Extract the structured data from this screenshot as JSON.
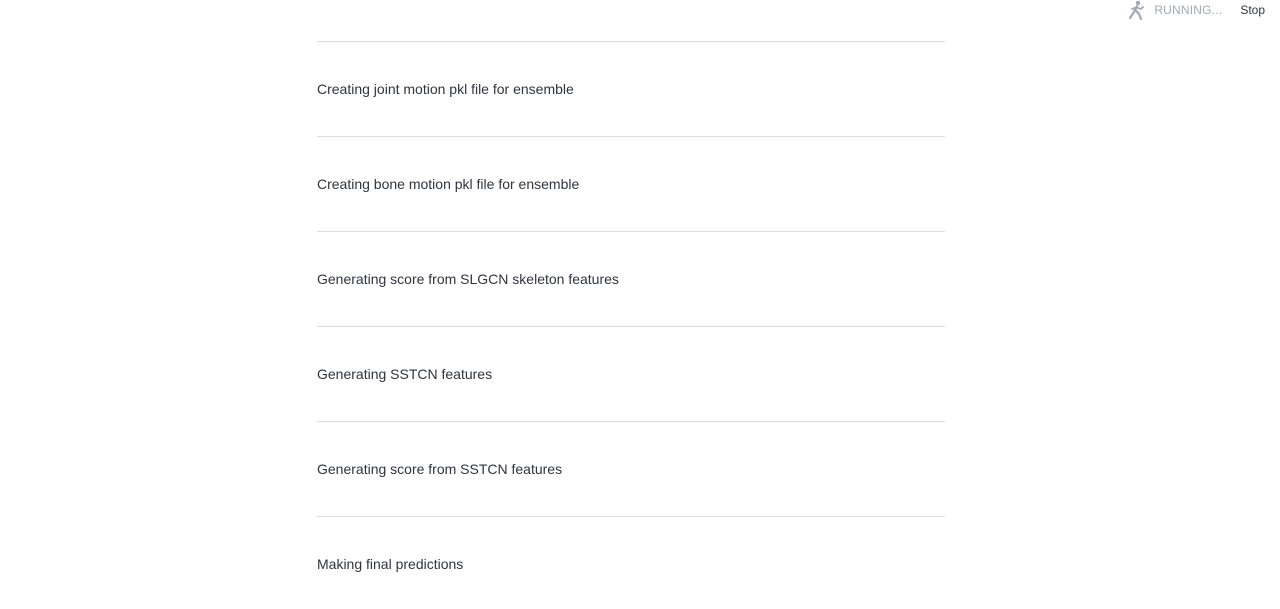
{
  "status": {
    "running_label": "RUNNING...",
    "stop_label": "Stop",
    "icon": "running-person-icon"
  },
  "steps": [
    {
      "label": "Creating joint motion pkl file for ensemble"
    },
    {
      "label": "Creating bone motion pkl file for ensemble"
    },
    {
      "label": "Generating score from SLGCN skeleton features"
    },
    {
      "label": "Generating SSTCN features"
    },
    {
      "label": "Generating score from SSTCN features"
    },
    {
      "label": "Making final predictions"
    }
  ],
  "colors": {
    "divider": "#dcdde0",
    "text": "#31333f",
    "muted": "#a3a8b4"
  }
}
